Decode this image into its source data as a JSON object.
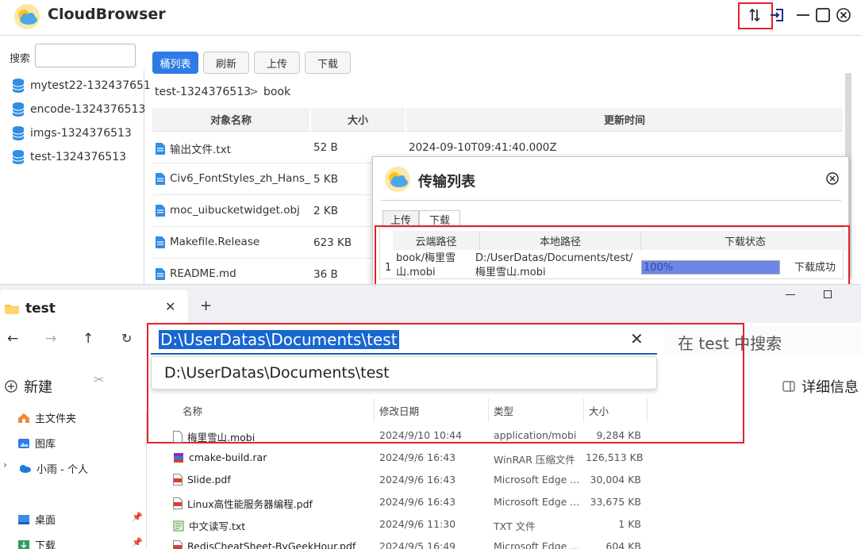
{
  "cloudbrowser": {
    "title": "CloudBrowser",
    "search_label": "搜索",
    "search_value": "",
    "buckets": [
      "mytest22-132437651",
      "encode-1324376513",
      "imgs-1324376513",
      "test-1324376513"
    ],
    "buttons": {
      "bucket_list": "桶列表",
      "refresh": "刷新",
      "upload": "上传",
      "download": "下载"
    },
    "breadcrumb": {
      "bucket": "test-1324376513",
      "separator": ">",
      "folder": "book"
    },
    "columns": {
      "name": "对象名称",
      "size": "大小",
      "updated": "更新时间"
    },
    "files": [
      {
        "name": "输出文件.txt",
        "size": "52 B",
        "updated": "2024-09-10T09:41:40.000Z"
      },
      {
        "name": "Civ6_FontStyles_zh_Hans_...",
        "size": "5 KB",
        "updated": ""
      },
      {
        "name": "moc_uibucketwidget.obj",
        "size": "2 KB",
        "updated": ""
      },
      {
        "name": "Makefile.Release",
        "size": "623 KB",
        "updated": ""
      },
      {
        "name": "README.md",
        "size": "36 B",
        "updated": ""
      }
    ]
  },
  "transfer_dialog": {
    "title": "传输列表",
    "tabs": {
      "upload": "上传",
      "download": "下载"
    },
    "columns": {
      "cloud_path": "云端路径",
      "local_path": "本地路径",
      "status": "下载状态"
    },
    "row": {
      "index": "1",
      "cloud_path_line1": "book/梅里雪",
      "cloud_path_line2": "山.mobi",
      "local_path_line1": "D:/UserDatas/Documents/test/",
      "local_path_line2": "梅里雪山.mobi",
      "progress_text": "100%",
      "progress": 1.0,
      "status": "下载成功"
    }
  },
  "explorer": {
    "tab_title": "test",
    "address": "D:\\UserDatas\\Documents\\test",
    "suggestion": "D:\\UserDatas\\Documents\\test",
    "search_placeholder": "在 test 中搜索",
    "new_label": "新建",
    "details_label": "详细信息",
    "nav": {
      "home": "主文件夹",
      "gallery": "图库",
      "onedrive": "小雨 - 个人",
      "desktop": "桌面",
      "downloads": "下载"
    },
    "columns": {
      "name": "名称",
      "modified": "修改日期",
      "type": "类型",
      "size": "大小"
    },
    "files": [
      {
        "name": "梅里雪山.mobi",
        "modified": "2024/9/10 10:44",
        "type": "application/mobi",
        "size": "9,284 KB",
        "icon": "file-icon"
      },
      {
        "name": "cmake-build.rar",
        "modified": "2024/9/6 16:43",
        "type": "WinRAR 压缩文件",
        "size": "126,513 KB",
        "icon": "rar-icon"
      },
      {
        "name": "Slide.pdf",
        "modified": "2024/9/6 16:43",
        "type": "Microsoft Edge ...",
        "size": "30,004 KB",
        "icon": "pdf-icon"
      },
      {
        "name": "Linux高性能服务器编程.pdf",
        "modified": "2024/9/6 16:43",
        "type": "Microsoft Edge ...",
        "size": "33,675 KB",
        "icon": "pdf-icon"
      },
      {
        "name": "中文读写.txt",
        "modified": "2024/9/6 11:30",
        "type": "TXT 文件",
        "size": "1 KB",
        "icon": "txt-icon"
      },
      {
        "name": "RedisCheatSheet-ByGeekHour.pdf",
        "modified": "2024/9/5 16:49",
        "type": "Microsoft Edge ...",
        "size": "604 KB",
        "icon": "pdf-icon"
      }
    ]
  },
  "colors": {
    "accent": "#2f7be5",
    "highlight": "#e0242b",
    "progress": "#6f86e8",
    "address_select": "#1767d0"
  }
}
